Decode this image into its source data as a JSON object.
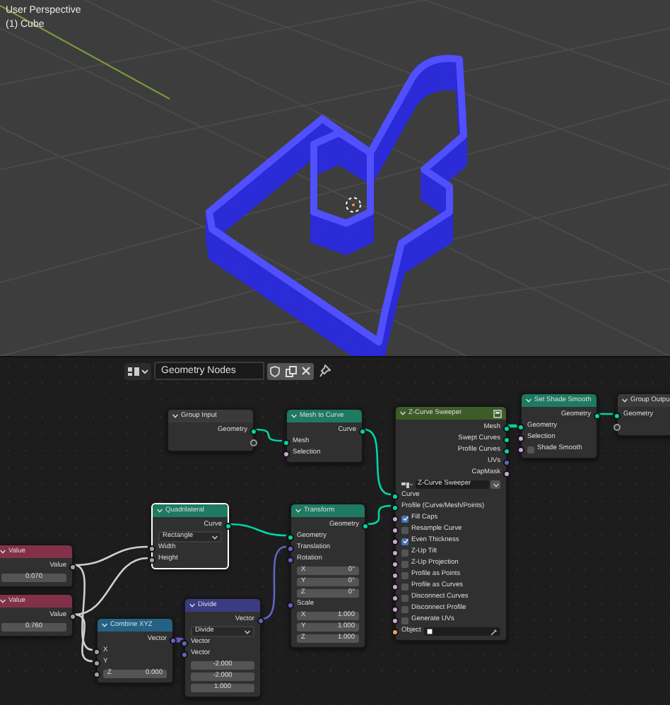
{
  "viewport": {
    "view_name": "User Perspective",
    "object_label": "(1) Cube"
  },
  "node_editor": {
    "tree_name": "Geometry Nodes",
    "nodes": [
      {
        "title": "Group Input",
        "kind": "builtin",
        "color": "#3a3a3a",
        "selected": false,
        "rows": [
          {
            "kind": "output",
            "label": "Geometry",
            "color": "#00d6a3"
          },
          {
            "kind": "virtual-output"
          }
        ]
      },
      {
        "title": "Mesh to Curve",
        "kind": "builtin",
        "color": "#1e7a60",
        "selected": false,
        "rows": [
          {
            "kind": "output",
            "label": "Curve",
            "color": "#00d6a3"
          },
          {
            "kind": "input",
            "label": "Mesh",
            "color": "#00d6a3"
          },
          {
            "kind": "input",
            "label": "Selection",
            "color": "#cca6d6"
          }
        ]
      },
      {
        "title": "Z-Curve Sweeper",
        "kind": "group",
        "color": "#3d5c28",
        "selected": false,
        "rows": [
          {
            "kind": "output",
            "label": "Mesh",
            "color": "#00d6a3"
          },
          {
            "kind": "output",
            "label": "Swept Curves",
            "color": "#00d6a3"
          },
          {
            "kind": "output",
            "label": "Profile Curves",
            "color": "#00d6a3"
          },
          {
            "kind": "output",
            "label": "UVs",
            "color": "#6363c7"
          },
          {
            "kind": "output",
            "label": "CapMask",
            "color": "#cca6d6"
          },
          {
            "kind": "group-selector",
            "value": "Z-Curve Sweeper"
          },
          {
            "kind": "input",
            "label": "Curve",
            "color": "#00d6a3"
          },
          {
            "kind": "input",
            "label": "Profile (Curve/Mesh/Points)",
            "color": "#00d6a3"
          },
          {
            "kind": "checkbox",
            "label": "Fill Caps",
            "checked": true,
            "color": "#cca6d6"
          },
          {
            "kind": "checkbox",
            "label": "Resample Curve",
            "checked": false,
            "color": "#cca6d6"
          },
          {
            "kind": "checkbox",
            "label": "Even Thickness",
            "checked": true,
            "color": "#cca6d6"
          },
          {
            "kind": "checkbox",
            "label": "Z-Up Tilt",
            "checked": false,
            "color": "#cca6d6"
          },
          {
            "kind": "checkbox",
            "label": "Z-Up Projection",
            "checked": false,
            "color": "#cca6d6"
          },
          {
            "kind": "checkbox",
            "label": "Profile as Points",
            "checked": false,
            "color": "#cca6d6"
          },
          {
            "kind": "checkbox",
            "label": "Profile as Curves",
            "checked": false,
            "color": "#cca6d6"
          },
          {
            "kind": "checkbox",
            "label": "Disconnect Curves",
            "checked": false,
            "color": "#cca6d6"
          },
          {
            "kind": "checkbox",
            "label": "Disconnect Profile",
            "checked": false,
            "color": "#cca6d6"
          },
          {
            "kind": "checkbox",
            "label": "Generate UVs",
            "checked": false,
            "color": "#cca6d6"
          },
          {
            "kind": "object-field",
            "label": "Object",
            "color": "#ed9e5c"
          }
        ]
      },
      {
        "title": "Set Shade Smooth",
        "kind": "builtin",
        "color": "#1e7a60",
        "selected": false,
        "rows": [
          {
            "kind": "output",
            "label": "Geometry",
            "color": "#00d6a3"
          },
          {
            "kind": "input",
            "label": "Geometry",
            "color": "#00d6a3"
          },
          {
            "kind": "input",
            "label": "Selection",
            "color": "#cca6d6"
          },
          {
            "kind": "checkbox",
            "label": "Shade Smooth",
            "checked": false,
            "color": "#cca6d6"
          }
        ]
      },
      {
        "title": "Group Outpu",
        "kind": "builtin",
        "color": "#3a3a3a",
        "selected": false,
        "rows": [
          {
            "kind": "input",
            "label": "Geometry",
            "color": "#00d6a3"
          },
          {
            "kind": "virtual-input"
          }
        ]
      },
      {
        "title": "Quadrilateral",
        "kind": "builtin",
        "color": "#1e7a60",
        "selected": true,
        "rows": [
          {
            "kind": "output",
            "label": "Curve",
            "color": "#00d6a3"
          },
          {
            "kind": "dropdown",
            "value": "Rectangle"
          },
          {
            "kind": "input",
            "label": "Width",
            "color": "#a1a1a1"
          },
          {
            "kind": "input",
            "label": "Height",
            "color": "#a1a1a1"
          }
        ]
      },
      {
        "title": "Value",
        "kind": "builtin",
        "color": "#83314a",
        "selected": false,
        "rows": [
          {
            "kind": "output",
            "label": "Value",
            "color": "#a1a1a1"
          },
          {
            "kind": "field",
            "value": "0.070"
          }
        ]
      },
      {
        "title": "Value",
        "kind": "builtin",
        "color": "#83314a",
        "selected": false,
        "rows": [
          {
            "kind": "output",
            "label": "Value",
            "color": "#a1a1a1"
          },
          {
            "kind": "field",
            "value": "0.760"
          }
        ]
      },
      {
        "title": "Combine XYZ",
        "kind": "builtin",
        "color": "#246283",
        "selected": false,
        "rows": [
          {
            "kind": "output",
            "label": "Vector",
            "color": "#6363c7"
          },
          {
            "kind": "input",
            "label": "X",
            "color": "#a1a1a1"
          },
          {
            "kind": "input",
            "label": "Y",
            "color": "#a1a1a1"
          },
          {
            "kind": "field",
            "label": "Z",
            "value": "0.000",
            "color": "#a1a1a1"
          }
        ]
      },
      {
        "title": "Divide",
        "kind": "builtin",
        "color": "#3b3b83",
        "selected": false,
        "rows": [
          {
            "kind": "output",
            "label": "Vector",
            "color": "#6363c7"
          },
          {
            "kind": "dropdown",
            "value": "Divide"
          },
          {
            "kind": "input",
            "label": "Vector",
            "color": "#6363c7"
          },
          {
            "kind": "label",
            "label": "Vector",
            "color": "#6363c7"
          },
          {
            "kind": "field",
            "value": "-2.000"
          },
          {
            "kind": "field",
            "value": "-2.000"
          },
          {
            "kind": "field",
            "value": "1.000"
          }
        ]
      },
      {
        "title": "Transform",
        "kind": "builtin",
        "color": "#1e7a60",
        "selected": false,
        "rows": [
          {
            "kind": "output",
            "label": "Geometry",
            "color": "#00d6a3"
          },
          {
            "kind": "input",
            "label": "Geometry",
            "color": "#00d6a3"
          },
          {
            "kind": "input",
            "label": "Translation",
            "color": "#6363c7"
          },
          {
            "kind": "label",
            "label": "Rotation",
            "color": "#6363c7"
          },
          {
            "kind": "field",
            "label": "X",
            "value": "0°"
          },
          {
            "kind": "field",
            "label": "Y",
            "value": "0°"
          },
          {
            "kind": "field",
            "label": "Z",
            "value": "0°"
          },
          {
            "kind": "label",
            "label": "Scale",
            "color": "#6363c7"
          },
          {
            "kind": "field",
            "label": "X",
            "value": "1.000"
          },
          {
            "kind": "field",
            "label": "Y",
            "value": "1.000"
          },
          {
            "kind": "field",
            "label": "Z",
            "value": "1.000"
          }
        ]
      }
    ]
  }
}
